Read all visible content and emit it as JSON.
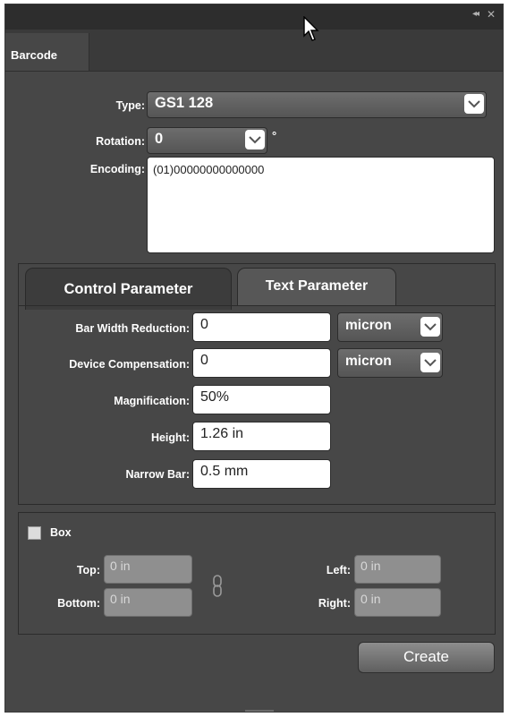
{
  "window": {
    "collapse_glyph": "◂◂",
    "close_glyph": "✕"
  },
  "tab": {
    "label": "Barcode"
  },
  "form": {
    "type_label": "Type:",
    "type_value": "GS1 128",
    "rotation_label": "Rotation:",
    "rotation_value": "0",
    "degree_symbol": "°",
    "encoding_label": "Encoding:",
    "encoding_value": "(01)00000000000000"
  },
  "param_tabs": {
    "active": "Control Parameter",
    "inactive": "Text Parameter"
  },
  "params": {
    "bar_width_reduction": {
      "label": "Bar Width Reduction:",
      "value": "0",
      "unit": "micron"
    },
    "device_compensation": {
      "label": "Device Compensation:",
      "value": "0",
      "unit": "micron"
    },
    "magnification": {
      "label": "Magnification:",
      "value": "50%"
    },
    "height": {
      "label": "Height:",
      "value": "1.26 in"
    },
    "narrow_bar": {
      "label": "Narrow Bar:",
      "value": "0.5 mm"
    }
  },
  "box": {
    "label": "Box",
    "checked": false,
    "top": {
      "label": "Top:",
      "value": "0 in"
    },
    "bottom": {
      "label": "Bottom:",
      "value": "0 in"
    },
    "left": {
      "label": "Left:",
      "value": "0 in"
    },
    "right": {
      "label": "Right:",
      "value": "0 in"
    }
  },
  "actions": {
    "create_label": "Create"
  },
  "colors": {
    "panel_bg": "#474747",
    "titlebar_bg": "#2d2d2d",
    "field_bg": "#ffffff",
    "disabled_field_bg": "#8f8f8f"
  }
}
